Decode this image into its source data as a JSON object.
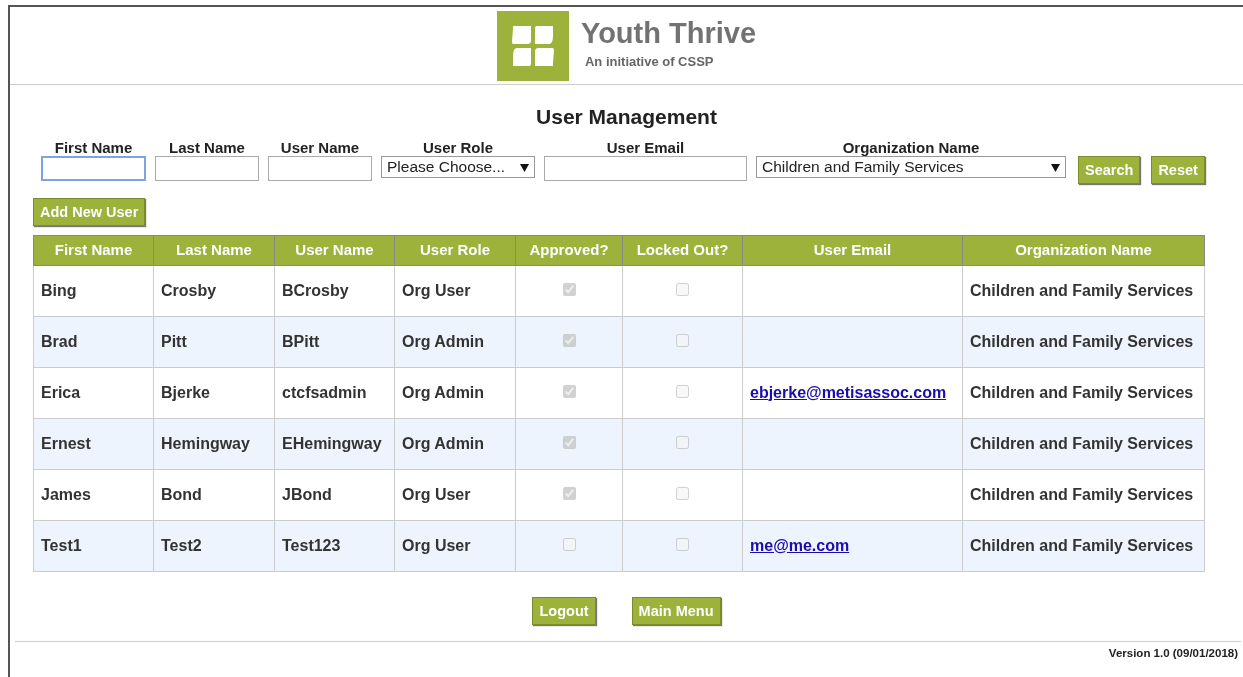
{
  "logo": {
    "title": "Youth Thrive",
    "subtitle": "An initiative of CSSP"
  },
  "heading": "User Management",
  "filters": [
    {
      "kind": "text",
      "label": "First Name",
      "focused": true
    },
    {
      "kind": "text",
      "label": "Last Name",
      "focused": false
    },
    {
      "kind": "text",
      "label": "User Name",
      "focused": false
    },
    {
      "kind": "select",
      "label": "User Role",
      "value": "Please Choose...",
      "focused": false
    },
    {
      "kind": "text",
      "label": "User Email",
      "focused": false
    },
    {
      "kind": "select",
      "label": "Organization Name",
      "value": "Children and Family Services",
      "focused": false
    }
  ],
  "filter_buttons": [
    "Search",
    "Reset"
  ],
  "add_button": "Add New User",
  "table": {
    "columns": [
      "First Name",
      "Last Name",
      "User Name",
      "User Role",
      "Approved?",
      "Locked Out?",
      "User Email",
      "Organization Name"
    ],
    "rows": [
      {
        "first_name": "Bing",
        "last_name": "Crosby",
        "user_name": "BCrosby",
        "user_role": "Org User",
        "approved": true,
        "locked_out": false,
        "organization": "Children and Family Services"
      },
      {
        "first_name": "Brad",
        "last_name": "Pitt",
        "user_name": "BPitt",
        "user_role": "Org Admin",
        "approved": true,
        "locked_out": false,
        "organization": "Children and Family Services"
      },
      {
        "first_name": "Erica",
        "last_name": "Bjerke",
        "user_name": "ctcfsadmin",
        "user_role": "Org Admin",
        "approved": true,
        "locked_out": false,
        "email": "ebjerke@metisassoc.com",
        "organization": "Children and Family Services"
      },
      {
        "first_name": "Ernest",
        "last_name": "Hemingway",
        "user_name": "EHemingway",
        "user_role": "Org Admin",
        "approved": true,
        "locked_out": false,
        "organization": "Children and Family Services"
      },
      {
        "first_name": "James",
        "last_name": "Bond",
        "user_name": "JBond",
        "user_role": "Org User",
        "approved": true,
        "locked_out": false,
        "organization": "Children and Family Services"
      },
      {
        "first_name": "Test1",
        "last_name": "Test2",
        "user_name": "Test123",
        "user_role": "Org User",
        "approved": false,
        "locked_out": false,
        "email": "me@me.com",
        "organization": "Children and Family Services"
      }
    ]
  },
  "footer_buttons": [
    "Logout",
    "Main Menu"
  ],
  "version": "Version 1.0 (09/01/2018)"
}
